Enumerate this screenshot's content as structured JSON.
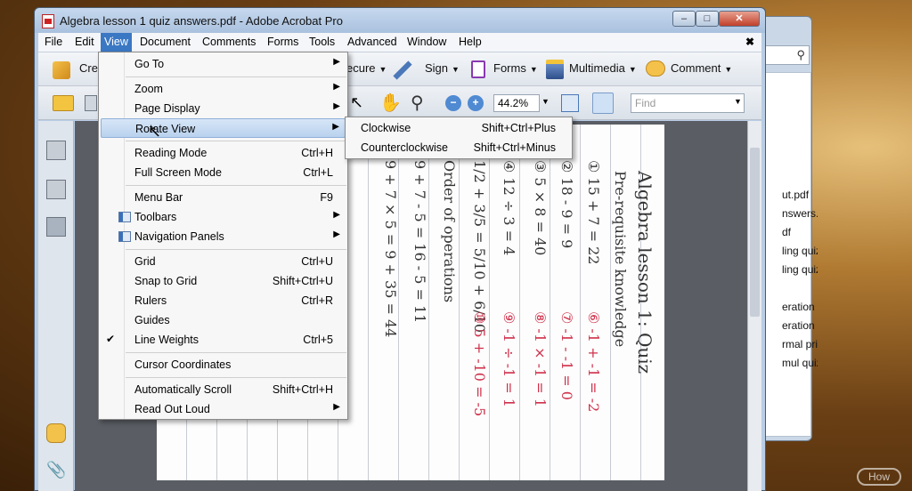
{
  "window": {
    "title": "Algebra lesson 1 quiz answers.pdf - Adobe Acrobat Pro",
    "min_glyph": "–",
    "max_glyph": "□",
    "close_glyph": "✕"
  },
  "menubar": {
    "items": [
      "File",
      "Edit",
      "View",
      "Document",
      "Comments",
      "Forms",
      "Tools",
      "Advanced",
      "Window",
      "Help"
    ],
    "active": "View",
    "close_glyph": "✖"
  },
  "toolbar1": {
    "create_label": "Crea",
    "secure_label": "ecure",
    "sign_label": "Sign",
    "forms_label": "Forms",
    "multimedia_label": "Multimedia",
    "comment_label": "Comment"
  },
  "toolbar2": {
    "zoom_value": "44.2%",
    "find_placeholder": "Find"
  },
  "view_menu": {
    "go_to": "Go To",
    "zoom": "Zoom",
    "page_display": "Page Display",
    "rotate_view": "Rotate View",
    "reading_mode": "Reading Mode",
    "reading_mode_sc": "Ctrl+H",
    "full_screen": "Full Screen Mode",
    "full_screen_sc": "Ctrl+L",
    "menu_bar": "Menu Bar",
    "menu_bar_sc": "F9",
    "toolbars": "Toolbars",
    "navigation_panels": "Navigation Panels",
    "grid": "Grid",
    "grid_sc": "Ctrl+U",
    "snap_to_grid": "Snap to Grid",
    "snap_to_grid_sc": "Shift+Ctrl+U",
    "rulers": "Rulers",
    "rulers_sc": "Ctrl+R",
    "guides": "Guides",
    "line_weights": "Line Weights",
    "line_weights_sc": "Ctrl+5",
    "cursor_coordinates": "Cursor Coordinates",
    "auto_scroll": "Automatically Scroll",
    "auto_scroll_sc": "Shift+Ctrl+H",
    "read_out_loud": "Read Out Loud"
  },
  "rotate_menu": {
    "clockwise": "Clockwise",
    "clockwise_sc": "Shift+Ctrl+Plus",
    "counterclockwise": "Counterclockwise",
    "counterclockwise_sc": "Shift+Ctrl+Minus"
  },
  "document": {
    "heading": "Algebra lesson 1: Quiz",
    "subheading": "Pre-requisite knowledge",
    "col1": "① 15 + 7 = 22",
    "col2": "② 18 - 9 = 9",
    "col3": "③ 5 × 8 = 40",
    "col4": "④ 12 ÷ 3 = 4",
    "col5": "1/2 + 3/5 = 5/10 + 6/10",
    "col6": "Order of operations",
    "col7": "9 + 7 - 5 = 16 - 5 = 11",
    "col8": "9 + 7 × 5 = 9 + 35 = 44",
    "col9": "⑥ -1 + -1 = -2",
    "col10": "⑦ -1 - -1 = 0",
    "col11": "⑧ -1 × -1 = 1",
    "col12": "⑨ -1 ÷ -1 = 1",
    "col13": "⑩ 5 + -10 = -5"
  },
  "background_window": {
    "items": [
      "ut.pdf",
      "nswers.pd",
      "df",
      "ling quiz",
      "ling quiz.",
      "eration q",
      "eration qu",
      "rmal prin",
      "mul quiz"
    ]
  },
  "watermark": "How"
}
